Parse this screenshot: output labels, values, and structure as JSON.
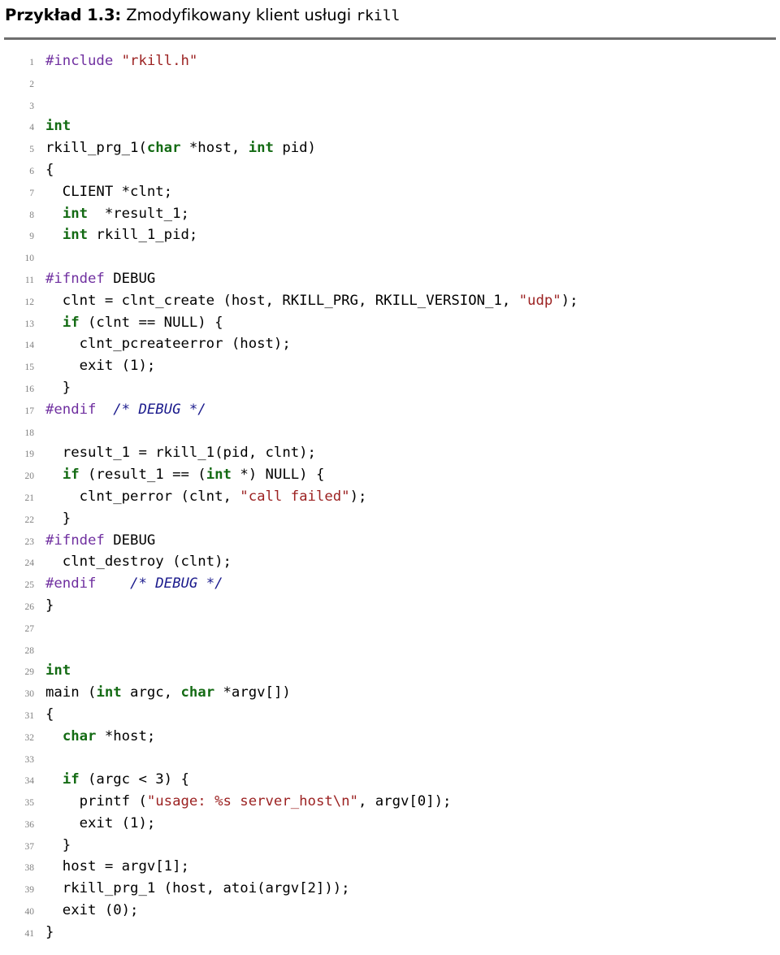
{
  "caption": {
    "label": "Przykład 1.3:",
    "text": " Zmodyfikowany klient usługi ",
    "mono": "rkill"
  },
  "colors": {
    "keyword": "#146b14",
    "preprocessor": "#7030a0",
    "string": "#9c2222",
    "comment": "#1a1a8c",
    "plain": "#000000",
    "lineno": "#808080",
    "rule": "#6e6e6e",
    "background": "#ffffff"
  },
  "listing": {
    "language": "C",
    "first_line_number": 1,
    "last_line_number": 41,
    "lines": [
      {
        "no": "1",
        "tokens": [
          {
            "t": "pp",
            "v": "#include"
          },
          {
            "t": "n",
            "v": " "
          },
          {
            "t": "s",
            "v": "\"rkill.h\""
          }
        ]
      },
      {
        "no": "2",
        "tokens": []
      },
      {
        "no": "3",
        "tokens": []
      },
      {
        "no": "4",
        "tokens": [
          {
            "t": "k",
            "v": "int"
          }
        ]
      },
      {
        "no": "5",
        "tokens": [
          {
            "t": "n",
            "v": "rkill_prg_1("
          },
          {
            "t": "k",
            "v": "char"
          },
          {
            "t": "n",
            "v": " *host, "
          },
          {
            "t": "k",
            "v": "int"
          },
          {
            "t": "n",
            "v": " pid)"
          }
        ]
      },
      {
        "no": "6",
        "tokens": [
          {
            "t": "n",
            "v": "{"
          }
        ]
      },
      {
        "no": "7",
        "tokens": [
          {
            "t": "n",
            "v": "  CLIENT *clnt;"
          }
        ]
      },
      {
        "no": "8",
        "tokens": [
          {
            "t": "n",
            "v": "  "
          },
          {
            "t": "k",
            "v": "int"
          },
          {
            "t": "n",
            "v": "  *result_1;"
          }
        ]
      },
      {
        "no": "9",
        "tokens": [
          {
            "t": "n",
            "v": "  "
          },
          {
            "t": "k",
            "v": "int"
          },
          {
            "t": "n",
            "v": " rkill_1_pid;"
          }
        ]
      },
      {
        "no": "10",
        "tokens": []
      },
      {
        "no": "11",
        "tokens": [
          {
            "t": "pp",
            "v": "#ifndef"
          },
          {
            "t": "n",
            "v": " DEBUG"
          }
        ]
      },
      {
        "no": "12",
        "tokens": [
          {
            "t": "n",
            "v": "  clnt = clnt_create (host, RKILL_PRG, RKILL_VERSION_1, "
          },
          {
            "t": "s",
            "v": "\"udp\""
          },
          {
            "t": "n",
            "v": ");"
          }
        ]
      },
      {
        "no": "13",
        "tokens": [
          {
            "t": "n",
            "v": "  "
          },
          {
            "t": "k",
            "v": "if"
          },
          {
            "t": "n",
            "v": " (clnt == NULL) {"
          }
        ]
      },
      {
        "no": "14",
        "tokens": [
          {
            "t": "n",
            "v": "    clnt_pcreateerror (host);"
          }
        ]
      },
      {
        "no": "15",
        "tokens": [
          {
            "t": "n",
            "v": "    exit (1);"
          }
        ]
      },
      {
        "no": "16",
        "tokens": [
          {
            "t": "n",
            "v": "  }"
          }
        ]
      },
      {
        "no": "17",
        "tokens": [
          {
            "t": "pp",
            "v": "#endif"
          },
          {
            "t": "n",
            "v": "  "
          },
          {
            "t": "c",
            "v": "/* DEBUG */"
          }
        ]
      },
      {
        "no": "18",
        "tokens": []
      },
      {
        "no": "19",
        "tokens": [
          {
            "t": "n",
            "v": "  result_1 = rkill_1(pid, clnt);"
          }
        ]
      },
      {
        "no": "20",
        "tokens": [
          {
            "t": "n",
            "v": "  "
          },
          {
            "t": "k",
            "v": "if"
          },
          {
            "t": "n",
            "v": " (result_1 == ("
          },
          {
            "t": "k",
            "v": "int"
          },
          {
            "t": "n",
            "v": " *) NULL) {"
          }
        ]
      },
      {
        "no": "21",
        "tokens": [
          {
            "t": "n",
            "v": "    clnt_perror (clnt, "
          },
          {
            "t": "s",
            "v": "\"call failed\""
          },
          {
            "t": "n",
            "v": ");"
          }
        ]
      },
      {
        "no": "22",
        "tokens": [
          {
            "t": "n",
            "v": "  }"
          }
        ]
      },
      {
        "no": "23",
        "tokens": [
          {
            "t": "pp",
            "v": "#ifndef"
          },
          {
            "t": "n",
            "v": " DEBUG"
          }
        ]
      },
      {
        "no": "24",
        "tokens": [
          {
            "t": "n",
            "v": "  clnt_destroy (clnt);"
          }
        ]
      },
      {
        "no": "25",
        "tokens": [
          {
            "t": "pp",
            "v": "#endif"
          },
          {
            "t": "n",
            "v": "    "
          },
          {
            "t": "c",
            "v": "/* DEBUG */"
          }
        ]
      },
      {
        "no": "26",
        "tokens": [
          {
            "t": "n",
            "v": "}"
          }
        ]
      },
      {
        "no": "27",
        "tokens": []
      },
      {
        "no": "28",
        "tokens": []
      },
      {
        "no": "29",
        "tokens": [
          {
            "t": "k",
            "v": "int"
          }
        ]
      },
      {
        "no": "30",
        "tokens": [
          {
            "t": "n",
            "v": "main ("
          },
          {
            "t": "k",
            "v": "int"
          },
          {
            "t": "n",
            "v": " argc, "
          },
          {
            "t": "k",
            "v": "char"
          },
          {
            "t": "n",
            "v": " *argv[])"
          }
        ]
      },
      {
        "no": "31",
        "tokens": [
          {
            "t": "n",
            "v": "{"
          }
        ]
      },
      {
        "no": "32",
        "tokens": [
          {
            "t": "n",
            "v": "  "
          },
          {
            "t": "k",
            "v": "char"
          },
          {
            "t": "n",
            "v": " *host;"
          }
        ]
      },
      {
        "no": "33",
        "tokens": []
      },
      {
        "no": "34",
        "tokens": [
          {
            "t": "n",
            "v": "  "
          },
          {
            "t": "k",
            "v": "if"
          },
          {
            "t": "n",
            "v": " (argc < 3) {"
          }
        ]
      },
      {
        "no": "35",
        "tokens": [
          {
            "t": "n",
            "v": "    printf ("
          },
          {
            "t": "s",
            "v": "\"usage: %s server_host\\n\""
          },
          {
            "t": "n",
            "v": ", argv[0]);"
          }
        ]
      },
      {
        "no": "36",
        "tokens": [
          {
            "t": "n",
            "v": "    exit (1);"
          }
        ]
      },
      {
        "no": "37",
        "tokens": [
          {
            "t": "n",
            "v": "  }"
          }
        ]
      },
      {
        "no": "38",
        "tokens": [
          {
            "t": "n",
            "v": "  host = argv[1];"
          }
        ]
      },
      {
        "no": "39",
        "tokens": [
          {
            "t": "n",
            "v": "  rkill_prg_1 (host, atoi(argv[2]));"
          }
        ]
      },
      {
        "no": "40",
        "tokens": [
          {
            "t": "n",
            "v": "  exit (0);"
          }
        ]
      },
      {
        "no": "41",
        "tokens": [
          {
            "t": "n",
            "v": "}"
          }
        ]
      }
    ]
  }
}
